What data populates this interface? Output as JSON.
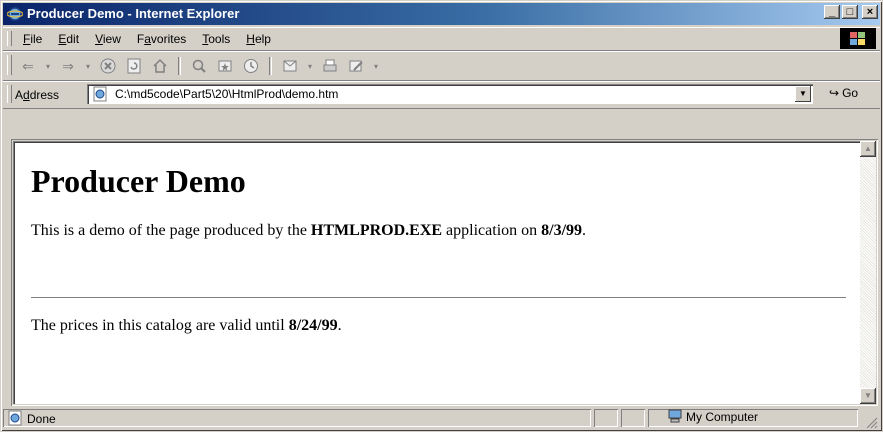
{
  "window": {
    "title": "Producer Demo - Internet Explorer"
  },
  "title_buttons": {
    "minimize": "_",
    "maximize": "□",
    "close": "×"
  },
  "menu": {
    "items": [
      {
        "pre": "",
        "key": "F",
        "post": "ile"
      },
      {
        "pre": "",
        "key": "E",
        "post": "dit"
      },
      {
        "pre": "",
        "key": "V",
        "post": "iew"
      },
      {
        "pre": "F",
        "key": "a",
        "post": "vorites"
      },
      {
        "pre": "",
        "key": "T",
        "post": "ools"
      },
      {
        "pre": "",
        "key": "H",
        "post": "elp"
      }
    ]
  },
  "toolbar": {
    "icons": [
      "back-icon",
      "forward-icon",
      "stop-icon",
      "refresh-icon",
      "home-icon",
      "search-icon",
      "favorites-icon",
      "history-icon",
      "mail-icon",
      "print-icon",
      "edit-icon"
    ]
  },
  "address": {
    "label_pre": "A",
    "label_key": "d",
    "label_post": "dress",
    "url": "C:\\md5code\\Part5\\20\\HtmlProd\\demo.htm",
    "go_label": "Go"
  },
  "document": {
    "heading": "Producer Demo",
    "p1_prefix": "This is a demo of the page produced by the ",
    "p1_app": "HTMLPROD.EXE",
    "p1_middle": " application on ",
    "p1_date": "8/3/99",
    "p1_suffix": ".",
    "p2_prefix": "The prices in this catalog are valid until ",
    "p2_date": "8/24/99",
    "p2_suffix": "."
  },
  "status": {
    "text": "Done",
    "zone": "My Computer"
  },
  "colors": {
    "title_start": "#0a246a",
    "title_end": "#a6caf0",
    "chrome": "#d4d0c8"
  }
}
